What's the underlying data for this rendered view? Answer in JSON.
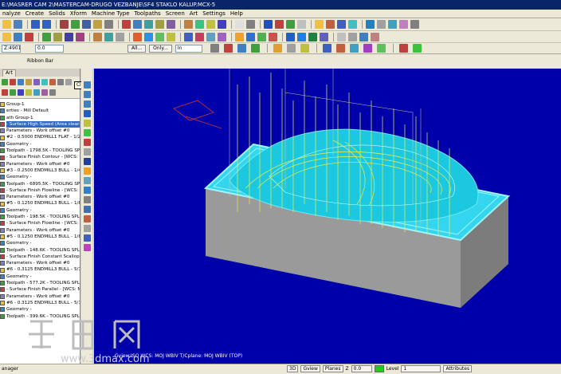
{
  "window": {
    "title": "E:\\MASRER CAM 2\\MASTERCAM-DRUGO VEZBANJE\\SF4 STAKLO KALUP.MCX-5"
  },
  "menu": [
    "nalyze",
    "Create",
    "Solids",
    "Xform",
    "Machine Type",
    "Toolpaths",
    "Screen",
    "Art",
    "Settings",
    "Help"
  ],
  "ribbon": {
    "field1": "Z:49019",
    "field2": "0.0",
    "all_button": "All...",
    "only_button": "Only...",
    "in_value": "In",
    "ribbon_bar_label": "Ribbon Bar"
  },
  "ops_panel": {
    "tab_label": "Art",
    "close_tooltip": "Close",
    "tree": [
      {
        "text": "Group-1",
        "selected": false
      },
      {
        "text": "erties - Mill Default",
        "selected": false
      },
      {
        "text": "ath Group-1",
        "selected": false
      },
      {
        "text": "- Surface High Speed (Area clearance)",
        "selected": true
      },
      {
        "text": "Parameters - Work offset #0",
        "selected": false
      },
      {
        "text": "#2 - 0.5000 ENDMILL1 FLAT - 1/2 FL",
        "selected": false
      },
      {
        "text": "Geometry -",
        "selected": false
      },
      {
        "text": "Toolpath - 1798.5K - TOOLING SPLIT",
        "selected": false
      },
      {
        "text": "- Surface Finish Contour - [WCS: MOJ",
        "selected": false
      },
      {
        "text": "Parameters - Work offset #0",
        "selected": false
      },
      {
        "text": "#3 - 0.2500 ENDMILL3 BULL - 1/4 BU",
        "selected": false
      },
      {
        "text": "Geometry -",
        "selected": false
      },
      {
        "text": "Toolpath - 6895.5K - TOOLING SPLIT",
        "selected": false
      },
      {
        "text": "- Surface Finish Flowline - [WCS: MOJ",
        "selected": false
      },
      {
        "text": "Parameters - Work offset #0",
        "selected": false
      },
      {
        "text": "#5 - 0.1250 ENDMILL3 BULL - 1/8 BU",
        "selected": false
      },
      {
        "text": "Geometry -",
        "selected": false
      },
      {
        "text": "Toolpath - 198.5K - TOOLING SPLIT",
        "selected": false
      },
      {
        "text": "- Surface Finish Flowline - [WCS: MOJ",
        "selected": false
      },
      {
        "text": "Parameters - Work offset #0",
        "selected": false
      },
      {
        "text": "#5 - 0.1250 ENDMILL3 BULL - 1/8 BU",
        "selected": false
      },
      {
        "text": "Geometry -",
        "selected": false
      },
      {
        "text": "Toolpath - 148.6K - TOOLING SPLIT",
        "selected": false
      },
      {
        "text": "- Surface Finish Constant Scallop - [WC",
        "selected": false
      },
      {
        "text": "Parameters - Work offset #0",
        "selected": false
      },
      {
        "text": "#6 - 0.3125 ENDMILL3 BULL - 5/16 B",
        "selected": false
      },
      {
        "text": "Geometry -",
        "selected": false
      },
      {
        "text": "Toolpath - 577.2K - TOOLING SPLIT",
        "selected": false
      },
      {
        "text": "- Surface Finish Parallel - [WCS: MOJ W",
        "selected": false
      },
      {
        "text": "Parameters - Work offset #0",
        "selected": false
      },
      {
        "text": "#6 - 0.3125 ENDMILL3 BULL - 5/16 B",
        "selected": false
      },
      {
        "text": "Geometry -",
        "selected": false
      },
      {
        "text": "Toolpath - 399.6K - TOOLING SPLIT",
        "selected": false
      }
    ]
  },
  "viewport": {
    "status": "Gview:ISO    WCS: MOJ WBIV    T/Cplane: MOJ WBIV (TOP)"
  },
  "statusbar": {
    "left": "anager",
    "view_mode": "3D",
    "gview": "Gview",
    "planes": "Planes",
    "z_label": "Z",
    "z_value": "0.0",
    "level_label": "Level",
    "level_value": "1",
    "attributes": "Attributes"
  },
  "watermark": {
    "url": "www.3dmax.com"
  },
  "colors": {
    "viewport_bg": "#0000aa",
    "surface": "#33d6ee",
    "toolpath": "#e8f04a",
    "stock": "#a8a8a8",
    "title_bg": "#0a246a"
  }
}
